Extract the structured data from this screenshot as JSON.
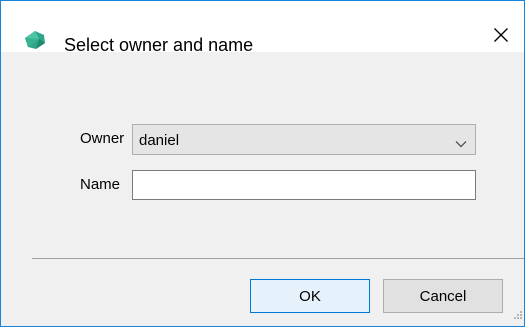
{
  "dialog": {
    "title": "Select owner and name",
    "app_icon": "app-logo-icon",
    "close_icon": "close-icon"
  },
  "form": {
    "owner_label": "Owner",
    "owner_value": "daniel",
    "owner_dropdown_icon": "chevron-down-icon",
    "name_label": "Name",
    "name_value": ""
  },
  "buttons": {
    "ok_label": "OK",
    "cancel_label": "Cancel"
  },
  "colors": {
    "window_border": "#1883d7",
    "default_button_border": "#0078d7",
    "default_button_bg": "#e5f1fb",
    "dialog_bg": "#f0f0f0",
    "app_icon_color": "#2fa58a"
  }
}
